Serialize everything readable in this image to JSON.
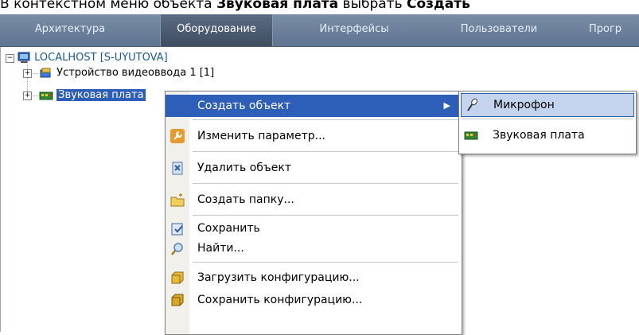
{
  "caption": {
    "prefix": "В контекстном меню объекта ",
    "bold1": "Звуковая плата",
    "middle": " выбрать ",
    "bold2": "Создать"
  },
  "tabs": [
    {
      "label": "Архитектура",
      "active": false
    },
    {
      "label": "Оборудование",
      "active": true
    },
    {
      "label": "Интерфейсы",
      "active": false
    },
    {
      "label": "Пользователи",
      "active": false
    },
    {
      "label": "Прогр",
      "active": false
    }
  ],
  "tree": {
    "root": "LOCALHOST [S-UYUTOVA]",
    "children": [
      "Устройство видеоввода 1 [1]",
      "Звуковая плата"
    ]
  },
  "context_menu": {
    "items": [
      {
        "label": "Создать объект",
        "icon": "none",
        "highlighted": true,
        "has_submenu": true
      },
      {
        "label": "Изменить параметр...",
        "icon": "wrench-icon"
      },
      {
        "label": "Удалить объект",
        "icon": "delete-icon"
      },
      {
        "label": "Создать папку...",
        "icon": "new-folder-icon"
      },
      {
        "label": "Сохранить",
        "icon": "save-icon"
      },
      {
        "label": "Найти...",
        "icon": "search-icon"
      },
      {
        "label": "Загрузить конфигурацию...",
        "icon": "load-config-icon"
      },
      {
        "label": "Сохранить конфигурацию...",
        "icon": "save-config-icon"
      }
    ]
  },
  "submenu": {
    "items": [
      {
        "label": "Микрофон",
        "icon": "microphone-icon",
        "highlighted": true
      },
      {
        "label": "Звуковая плата",
        "icon": "sound-card-icon",
        "highlighted": false
      }
    ]
  },
  "colors": {
    "tabbar": "#6a7e99",
    "menu_highlight": "#2e5fb8",
    "submenu_highlight": "#c4d3ee",
    "tree_root_text": "#1a5a8c"
  }
}
